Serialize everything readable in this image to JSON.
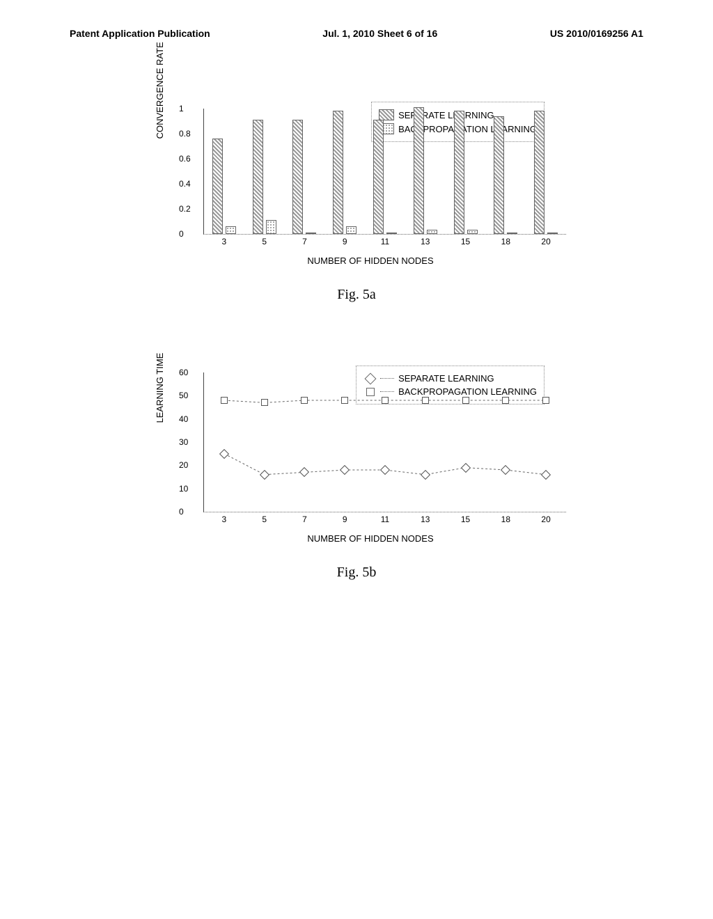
{
  "header": {
    "left": "Patent Application Publication",
    "center": "Jul. 1, 2010   Sheet 6 of 16",
    "right": "US 2010/0169256 A1"
  },
  "fig5a": {
    "caption": "Fig. 5a",
    "ylabel": "CONVERGENCE RATE",
    "xlabel": "NUMBER OF HIDDEN NODES",
    "legend": {
      "s1": "SEPARATE LEARNING",
      "s2": "BACKPROPAGATION LEARNING"
    }
  },
  "fig5b": {
    "caption": "Fig. 5b",
    "ylabel": "LEARNING TIME",
    "xlabel": "NUMBER OF HIDDEN NODES",
    "legend": {
      "s1": "SEPARATE LEARNING",
      "s2": "BACKPROPAGATION LEARNING"
    }
  },
  "chart_data": [
    {
      "id": "fig5a",
      "type": "bar",
      "title": "",
      "xlabel": "NUMBER OF HIDDEN NODES",
      "ylabel": "CONVERGENCE RATE",
      "ylim": [
        0,
        1
      ],
      "yticks": [
        0,
        0.2,
        0.4,
        0.6,
        0.8,
        1
      ],
      "categories": [
        "3",
        "5",
        "7",
        "9",
        "11",
        "13",
        "15",
        "18",
        "20"
      ],
      "series": [
        {
          "name": "SEPARATE LEARNING",
          "values": [
            0.75,
            0.9,
            0.9,
            0.97,
            0.9,
            1.0,
            0.97,
            0.93,
            0.97
          ]
        },
        {
          "name": "BACKPROPAGATION LEARNING",
          "values": [
            0.05,
            0.1,
            0.0,
            0.05,
            0.0,
            0.02,
            0.02,
            0.0,
            0.0
          ]
        }
      ],
      "legend_position": "top-right"
    },
    {
      "id": "fig5b",
      "type": "line",
      "title": "",
      "xlabel": "NUMBER OF HIDDEN NODES",
      "ylabel": "LEARNING TIME",
      "ylim": [
        0,
        60
      ],
      "yticks": [
        0,
        10,
        20,
        30,
        40,
        50,
        60
      ],
      "categories": [
        "3",
        "5",
        "7",
        "9",
        "11",
        "13",
        "15",
        "18",
        "20"
      ],
      "series": [
        {
          "name": "SEPARATE LEARNING",
          "marker": "diamond",
          "values": [
            25,
            16,
            17,
            18,
            18,
            16,
            19,
            18,
            16
          ]
        },
        {
          "name": "BACKPROPAGATION LEARNING",
          "marker": "square",
          "values": [
            48,
            47,
            48,
            48,
            48,
            48,
            48,
            48,
            48
          ]
        }
      ],
      "legend_position": "top-right"
    }
  ]
}
